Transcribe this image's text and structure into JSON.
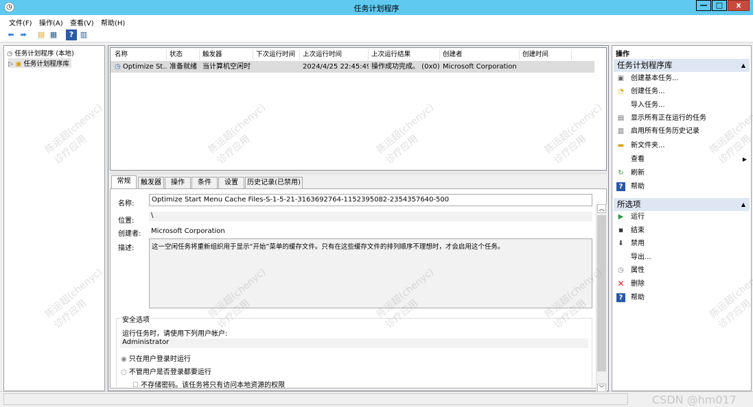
{
  "window": {
    "title": "任务计划程序",
    "min_label": "—",
    "max_label": "□",
    "close_label": "x"
  },
  "menu": {
    "file": "文件(F)",
    "action": "操作(A)",
    "view": "查看(V)",
    "help": "帮助(H)"
  },
  "tree": {
    "root": "任务计划程序 (本地)",
    "library": "任务计划程序库"
  },
  "columns": [
    "名称",
    "状态",
    "触发器",
    "下次运行时间",
    "上次运行时间",
    "上次运行结果",
    "创建者",
    "创建时间"
  ],
  "task_row": {
    "name": "Optimize St...",
    "status": "准备就绪",
    "trigger": "当计算机空闲时",
    "next_run": "",
    "last_run": "2024/4/25 22:45:49",
    "last_result": "操作成功完成。 (0x0)",
    "author": "Microsoft Corporation",
    "created": ""
  },
  "tabs": [
    "常规",
    "触发器",
    "操作",
    "条件",
    "设置",
    "历史记录(已禁用)"
  ],
  "general": {
    "name_label": "名称:",
    "name_value": "Optimize Start Menu Cache Files-S-1-5-21-3163692764-1152395082-2354357640-500",
    "location_label": "位置:",
    "location_value": "\\",
    "author_label": "创建者:",
    "author_value": "Microsoft Corporation",
    "description_label": "描述:",
    "description_value": "这一空闲任务将重新组织用于显示“开始”菜单的缓存文件。只有在这些缓存文件的排列顺序不理想时，才会启用这个任务。",
    "security_title": "安全选项",
    "run_as_text": "运行任务时，请使用下列用户帐户:",
    "account": "Administrator",
    "radio_logged_on": "只在用户登录时运行",
    "radio_whether": "不管用户是否登录都要运行",
    "checkbox_no_store": "不存储密码。该任务将只有访问本地资源的权限"
  },
  "actions_pane": {
    "header": "操作",
    "section1": "任务计划程序库",
    "items1": [
      "创建基本任务...",
      "创建任务...",
      "导入任务...",
      "显示所有正在运行的任务",
      "启用所有任务历史记录",
      "新文件夹...",
      "查看",
      "刷新",
      "帮助"
    ],
    "section2": "所选项",
    "items2": [
      "运行",
      "结束",
      "禁用",
      "导出...",
      "属性",
      "删除",
      "帮助"
    ]
  },
  "watermark": {
    "name": "陈运超(chenyc)",
    "dept": "诊疗应用",
    "csdn": "CSDN @hm017"
  },
  "colors": {
    "titlebar": "#5fc9ef",
    "close": "#c94a3d",
    "section": "#dde6f2"
  }
}
